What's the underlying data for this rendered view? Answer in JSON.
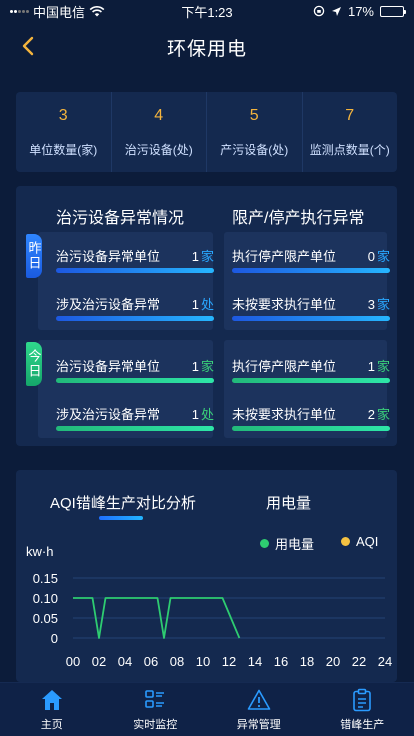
{
  "status_bar": {
    "carrier": "中国电信",
    "time": "下午1:23",
    "battery_percent": "17%",
    "battery_level": 0.17
  },
  "header": {
    "title": "环保用电",
    "back_icon": "chevron-left-icon"
  },
  "stats": [
    {
      "value": "3",
      "label": "单位数量(家)"
    },
    {
      "value": "4",
      "label": "治污设备(处)"
    },
    {
      "value": "5",
      "label": "产污设备(处)"
    },
    {
      "value": "7",
      "label": "监测点数量(个)"
    }
  ],
  "anomaly": {
    "left_title": "治污设备异常情况",
    "right_title": "限产/停产执行异常",
    "yesterday": {
      "tag": "昨日",
      "left": [
        {
          "name": "治污设备异常单位",
          "value": "1",
          "unit": "家"
        },
        {
          "name": "涉及治污设备异常",
          "value": "1",
          "unit": "处"
        }
      ],
      "right": [
        {
          "name": "执行停产限产单位",
          "value": "0",
          "unit": "家"
        },
        {
          "name": "未按要求执行单位",
          "value": "3",
          "unit": "家"
        }
      ]
    },
    "today": {
      "tag": "今日",
      "left": [
        {
          "name": "治污设备异常单位",
          "value": "1",
          "unit": "家"
        },
        {
          "name": "涉及治污设备异常",
          "value": "1",
          "unit": "处"
        }
      ],
      "right": [
        {
          "name": "执行停产限产单位",
          "value": "1",
          "unit": "家"
        },
        {
          "name": "未按要求执行单位",
          "value": "2",
          "unit": "家"
        }
      ]
    }
  },
  "colors": {
    "accent_orange": "#f4b43d",
    "blue_unit": "#29a7ff",
    "green_unit": "#3ad17a",
    "legend_power": "#2ecc71",
    "legend_aqi": "#f5c242",
    "tab_active": "#2a9bff"
  },
  "chart_tabs": {
    "active": "AQI错峰生产对比分析",
    "inactive": "用电量"
  },
  "chart_data": {
    "type": "line",
    "ylabel": "kw·h",
    "y_ticks": [
      "0.15",
      "0.10",
      "0.05",
      "0"
    ],
    "y_tick_values": [
      0.15,
      0.1,
      0.05,
      0
    ],
    "x_ticks": [
      "00",
      "02",
      "04",
      "06",
      "08",
      "10",
      "12",
      "14",
      "16",
      "18",
      "20",
      "22",
      "24"
    ],
    "xlim": [
      0,
      24
    ],
    "ylim": [
      0,
      0.15
    ],
    "series": [
      {
        "name": "用电量",
        "x": [
          0,
          1.5,
          2,
          2.5,
          6.5,
          7,
          7.5,
          11.5,
          12.8
        ],
        "y": [
          0.1,
          0.1,
          0,
          0.1,
          0.1,
          0,
          0.1,
          0.1,
          0
        ]
      },
      {
        "name": "AQI",
        "x": [],
        "y": []
      }
    ]
  },
  "tabbar": [
    {
      "label": "主页",
      "icon": "home-icon",
      "active": true
    },
    {
      "label": "实时监控",
      "icon": "list-icon",
      "active": false
    },
    {
      "label": "异常管理",
      "icon": "warning-icon",
      "active": false
    },
    {
      "label": "错峰生产",
      "icon": "clipboard-icon",
      "active": false
    }
  ]
}
